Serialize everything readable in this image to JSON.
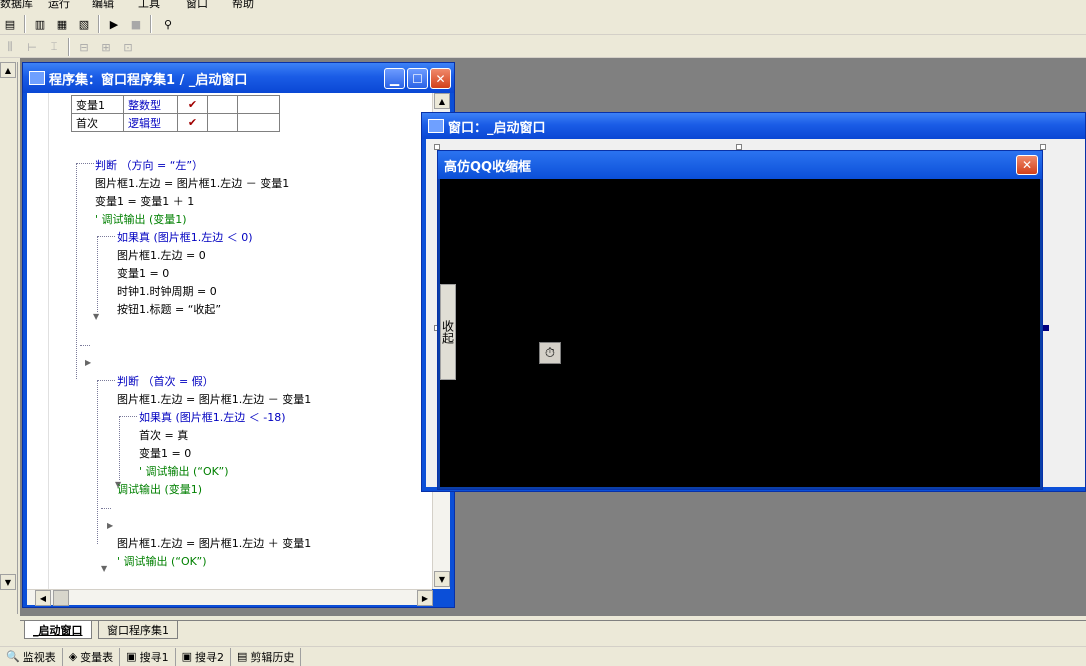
{
  "menu": [
    "数据库",
    "运行",
    "编辑",
    "工具",
    "窗口",
    "帮助"
  ],
  "toolbar": {
    "row1_icons": [
      "database-icon",
      "layout-1-icon",
      "layout-2-icon",
      "layout-3-icon",
      "run-icon",
      "stop-icon",
      "binoculars-icon"
    ],
    "row2_icons": [
      "align-v-icon",
      "align-h-icon",
      "align-center-icon",
      "same-width-icon",
      "same-height-icon",
      "same-size-icon"
    ]
  },
  "code_window": {
    "title": "程序集：窗口程序集1 / _启动窗口",
    "var_table": [
      {
        "name": "变量1",
        "type": "整数型",
        "static": "✔"
      },
      {
        "name": "首次",
        "type": "逻辑型",
        "static": "✔"
      }
    ],
    "lines": [
      {
        "text": "判断 （方向 = “左”）",
        "cls": "kw"
      },
      {
        "text": "图片框1.左边 = 图片框1.左边 － 变量1",
        "cls": ""
      },
      {
        "text": "变量1 = 变量1 ＋ 1",
        "cls": ""
      },
      {
        "text": "' 调试输出 (变量1)",
        "cls": "cm"
      },
      {
        "text": "如果真 (图片框1.左边 ＜ 0)",
        "cls": "kw"
      },
      {
        "text": "图片框1.左边 = 0",
        "cls": ""
      },
      {
        "text": "变量1 = 0",
        "cls": ""
      },
      {
        "text": "时钟1.时钟周期 = 0",
        "cls": ""
      },
      {
        "text": "按钮1.标题 = “收起”",
        "cls": ""
      },
      {
        "text": "判断 （首次 = 假）",
        "cls": "kw"
      },
      {
        "text": "图片框1.左边 = 图片框1.左边 － 变量1",
        "cls": ""
      },
      {
        "text": "如果真 (图片框1.左边 ＜ -18)",
        "cls": "kw"
      },
      {
        "text": "首次 = 真",
        "cls": ""
      },
      {
        "text": "变量1 = 0",
        "cls": ""
      },
      {
        "text": "' 调试输出 (“OK”)",
        "cls": "cm"
      },
      {
        "text": "调试输出 (变量1)",
        "cls": "cm"
      },
      {
        "text": "图片框1.左边 = 图片框1.左边 ＋ 变量1",
        "cls": ""
      },
      {
        "text": "' 调试输出 (“OK”)",
        "cls": "cm"
      }
    ]
  },
  "form_window": {
    "title": "窗口：_启动窗口",
    "inner_form_title": "高仿QQ收缩框",
    "collapse_button_label": "收起"
  },
  "tabs": [
    "_启动窗口",
    "窗口程序集1"
  ],
  "status_items": [
    {
      "icon": "magnifier-icon",
      "glyph": "🔍",
      "label": "监视表"
    },
    {
      "icon": "variables-icon",
      "glyph": "◈",
      "label": "变量表"
    },
    {
      "icon": "search-icon",
      "glyph": "▣",
      "label": "搜寻1"
    },
    {
      "icon": "search-icon",
      "glyph": "▣",
      "label": "搜寻2"
    },
    {
      "icon": "clipboard-icon",
      "glyph": "▤",
      "label": "剪辑历史"
    }
  ]
}
